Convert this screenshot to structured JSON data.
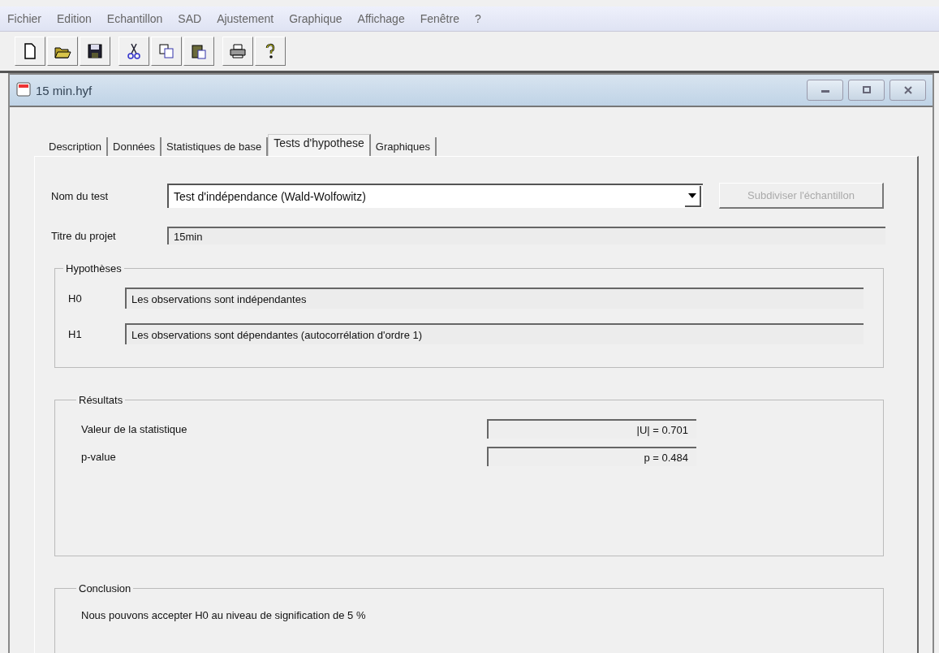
{
  "menu": [
    "Fichier",
    "Edition",
    "Echantillon",
    "SAD",
    "Ajustement",
    "Graphique",
    "Affichage",
    "Fenêtre",
    "?"
  ],
  "toolbar": [
    [
      {
        "kind": "new"
      },
      {
        "kind": "open"
      },
      {
        "kind": "save"
      }
    ],
    [
      {
        "kind": "cut"
      },
      {
        "kind": "copy"
      },
      {
        "kind": "paste"
      }
    ],
    [
      {
        "kind": "print"
      },
      {
        "kind": "help"
      }
    ]
  ],
  "window": {
    "title": "15 min.hyf",
    "controls": [
      {
        "kind": "minimize"
      },
      {
        "kind": "maximize"
      },
      {
        "kind": "close"
      }
    ]
  },
  "tabs": [
    {
      "label": "Description",
      "selected": false
    },
    {
      "label": "Données",
      "selected": false
    },
    {
      "label": "Statistiques de base",
      "selected": false
    },
    {
      "label": "Tests d'hypothese",
      "selected": true
    },
    {
      "label": "Graphiques",
      "selected": false
    }
  ],
  "test": {
    "label": "Nom du test",
    "value": "Test d'indépendance  (Wald-Wolfowitz)",
    "button": {
      "label": "Subdiviser l'échantillon",
      "disabled": true
    }
  },
  "project": {
    "label": "Titre du projet",
    "value": "15min"
  },
  "hypotheses": {
    "title": "Hypothèses",
    "items": [
      {
        "label": "H0",
        "value": "Les observations sont indépendantes"
      },
      {
        "label": "H1",
        "value": "Les observations sont dépendantes (autocorrélation d'ordre 1)"
      }
    ]
  },
  "results": {
    "title": "Résultats",
    "items": [
      {
        "label": "Valeur de la statistique",
        "value": "|U| =  0.701"
      },
      {
        "label": "p-value",
        "value": "p =  0.484"
      }
    ]
  },
  "conclusion": {
    "title": "Conclusion",
    "text": "Nous pouvons accepter H0 au niveau de signification de 5 %"
  }
}
